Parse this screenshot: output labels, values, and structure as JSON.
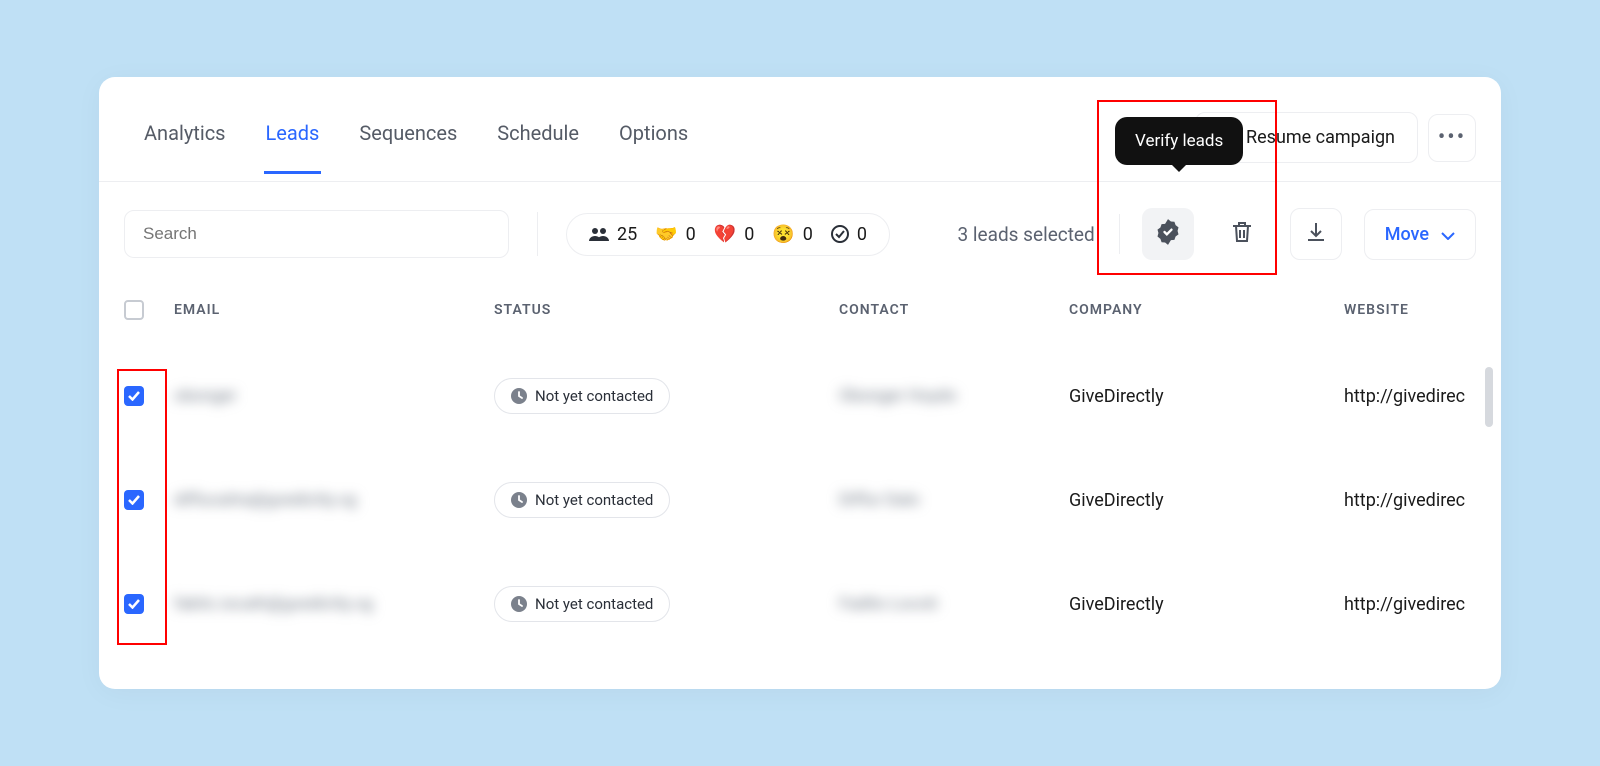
{
  "tabs": [
    "Analytics",
    "Leads",
    "Sequences",
    "Schedule",
    "Options"
  ],
  "active_tab_index": 1,
  "resume_label": "Resume campaign",
  "tooltip": "Verify leads",
  "search": {
    "placeholder": "Search"
  },
  "stats": {
    "people": "25",
    "handshake": "0",
    "heartbreak": "0",
    "dizzy": "0",
    "checkmark": "0"
  },
  "selected_label": "3 leads selected",
  "move_label": "Move",
  "columns": [
    "EMAIL",
    "STATUS",
    "CONTACT",
    "COMPANY",
    "WEBSITE"
  ],
  "status_text": "Not yet contacted",
  "rows": [
    {
      "checked": true,
      "email_blur": "obonger",
      "contact_blur": "Obonger Hoydo",
      "company": "GiveDirectly",
      "website": "http://givedirec"
    },
    {
      "checked": true,
      "email_blur": "diffucaitra@gvedictty.vg",
      "contact_blur": "Diffur Dalo",
      "company": "GiveDirectly",
      "website": "http://givedirec"
    },
    {
      "checked": true,
      "email_blur": "fakitc.iocath@gvedictty.vg",
      "contact_blur": "Fadito Locoti",
      "company": "GiveDirectly",
      "website": "http://givedirec"
    }
  ]
}
